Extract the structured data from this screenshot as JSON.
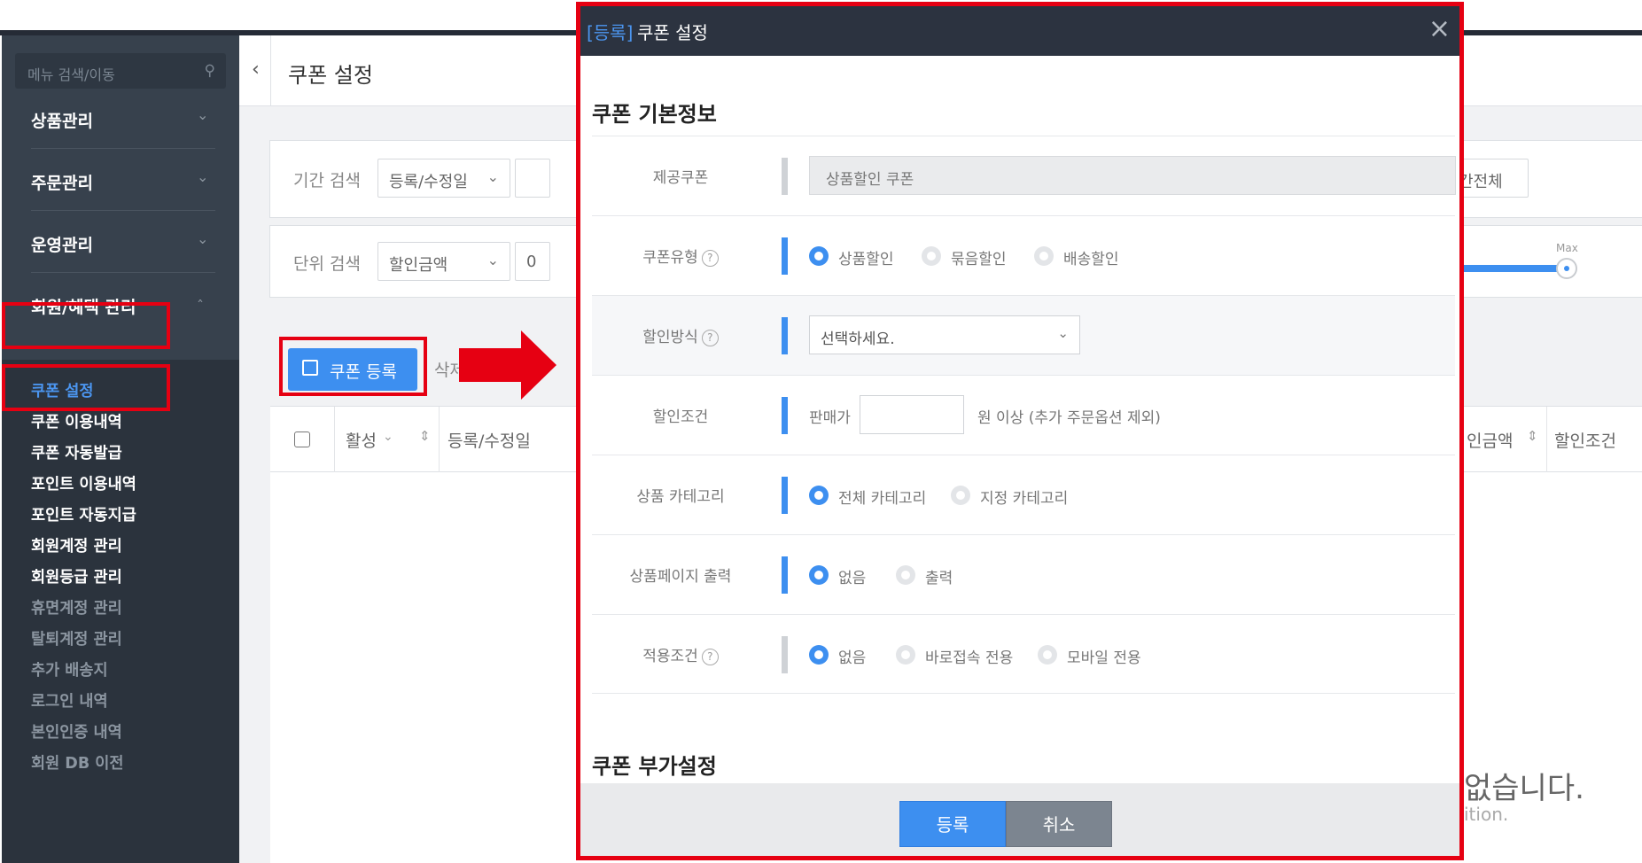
{
  "sidebar": {
    "search_placeholder": "메뉴 검색/이동",
    "categories": [
      {
        "label": "상품관리"
      },
      {
        "label": "주문관리"
      },
      {
        "label": "운영관리"
      },
      {
        "label": "회원/혜택 관리"
      }
    ],
    "sub_items": [
      {
        "label": "쿠폰 설정"
      },
      {
        "label": "쿠폰 이용내역"
      },
      {
        "label": "쿠폰 자동발급"
      },
      {
        "label": "포인트 이용내역"
      },
      {
        "label": "포인트 자동지급"
      },
      {
        "label": "회원계정 관리"
      },
      {
        "label": "회원등급 관리"
      },
      {
        "label": "휴면계정 관리"
      },
      {
        "label": "탈퇴계정 관리"
      },
      {
        "label": "추가 배송지"
      },
      {
        "label": "로그인 내역"
      },
      {
        "label": "본인인증 내역"
      },
      {
        "label": "회원 DB 이전"
      }
    ]
  },
  "page": {
    "title": "쿠폰 설정",
    "period_label": "기간 검색",
    "period_select": "등록/수정일",
    "period_all_btn": "간전체",
    "unit_label": "단위 검색",
    "unit_select": "할인금액",
    "unit_value": "0",
    "slider_max": "Max",
    "coupon_register_btn": "쿠폰 등록",
    "delete_btn": "삭제",
    "col_active": "활성",
    "col_date": "등록/수정일",
    "col_discount": "인금액",
    "col_condition": "할인조건",
    "empty_text": "없습니다.",
    "empty_sub": "ition."
  },
  "modal": {
    "tag": "[등록]",
    "title": "쿠폰 설정",
    "close": "×",
    "section_basic": "쿠폰 기본정보",
    "section_extra": "쿠폰 부가설정",
    "provide_label": "제공쿠폰",
    "provide_value": "상품할인 쿠폰",
    "type_label": "쿠폰유형",
    "type_options": [
      "상품할인",
      "묶음할인",
      "배송할인"
    ],
    "method_label": "할인방식",
    "method_placeholder": "선택하세요.",
    "cond_label": "할인조건",
    "cond_prefix": "판매가",
    "cond_suffix": "원 이상 (추가 주문옵션 제외)",
    "category_label": "상품 카테고리",
    "category_options": [
      "전체 카테고리",
      "지정 카테고리"
    ],
    "pageprint_label": "상품페이지 출력",
    "pageprint_options": [
      "없음",
      "출력"
    ],
    "apply_label": "적용조건",
    "apply_options": [
      "없음",
      "바로접속 전용",
      "모바일 전용"
    ],
    "submit": "등록",
    "cancel": "취소"
  },
  "icons": {
    "search": "search-icon",
    "back": "chevron-left-icon",
    "edit": "edit-icon",
    "help": "question-circle-icon",
    "arrow": "red-arrow-right-icon"
  },
  "colors": {
    "accent": "#3d8ff0",
    "sidebar": "#37414d",
    "highlight_box": "#e60012"
  }
}
